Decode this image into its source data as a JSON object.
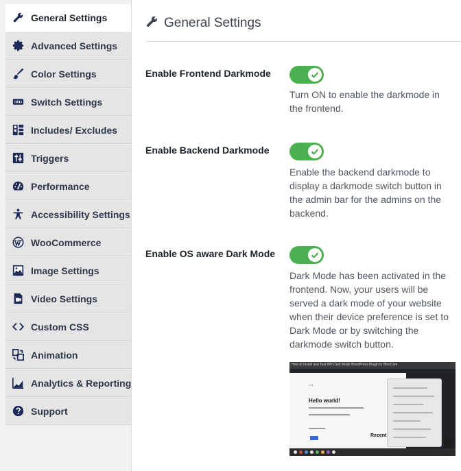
{
  "sidebar": {
    "items": [
      {
        "label": "General Settings",
        "icon": "wrench-icon",
        "active": true
      },
      {
        "label": "Advanced Settings",
        "icon": "gear-icon",
        "active": false
      },
      {
        "label": "Color Settings",
        "icon": "brush-icon",
        "active": false
      },
      {
        "label": "Switch Settings",
        "icon": "switch-icon",
        "active": false
      },
      {
        "label": "Includes/ Excludes",
        "icon": "layout-icon",
        "active": false
      },
      {
        "label": "Triggers",
        "icon": "sliders-icon",
        "active": false
      },
      {
        "label": "Performance",
        "icon": "speedometer-icon",
        "active": false
      },
      {
        "label": "Accessibility Settings",
        "icon": "accessibility-icon",
        "active": false
      },
      {
        "label": "WooCommerce",
        "icon": "wordpress-icon",
        "active": false
      },
      {
        "label": "Image Settings",
        "icon": "image-icon",
        "active": false
      },
      {
        "label": "Video Settings",
        "icon": "video-icon",
        "active": false
      },
      {
        "label": "Custom CSS",
        "icon": "code-icon",
        "active": false
      },
      {
        "label": "Animation",
        "icon": "animation-icon",
        "active": false
      },
      {
        "label": "Analytics & Reporting",
        "icon": "chart-icon",
        "active": false
      },
      {
        "label": "Support",
        "icon": "help-icon",
        "active": false
      }
    ]
  },
  "main": {
    "title": "General Settings",
    "settings": [
      {
        "label": "Enable Frontend Darkmode",
        "enabled": true,
        "description_lines": [
          "Turn ON to enable the darkmode in",
          "the frontend."
        ]
      },
      {
        "label": "Enable Backend Darkmode",
        "enabled": true,
        "description_lines": [
          "Enable the backend darkmode to",
          "display a darkmode switch button in",
          "the admin bar for the admins on the",
          "backend."
        ]
      },
      {
        "label": "Enable OS aware Dark Mode",
        "enabled": true,
        "description_lines": [
          "Dark Mode has been activated in the",
          "frontend. Now, your users will be",
          "served a dark mode of your website",
          "when their device preference is set to",
          "Dark Mode or by switching the",
          "darkmode switch button."
        ]
      }
    ],
    "preview": {
      "title_bar": "How to Install and Test WP Dark Mode WordPress Plugin to WooCom",
      "heading": "Hello world!",
      "recent": "Recent"
    }
  },
  "colors": {
    "toggle_on": "#4caf50",
    "sidebar_bg": "#e5e5e5",
    "active_bg": "#ffffff"
  }
}
